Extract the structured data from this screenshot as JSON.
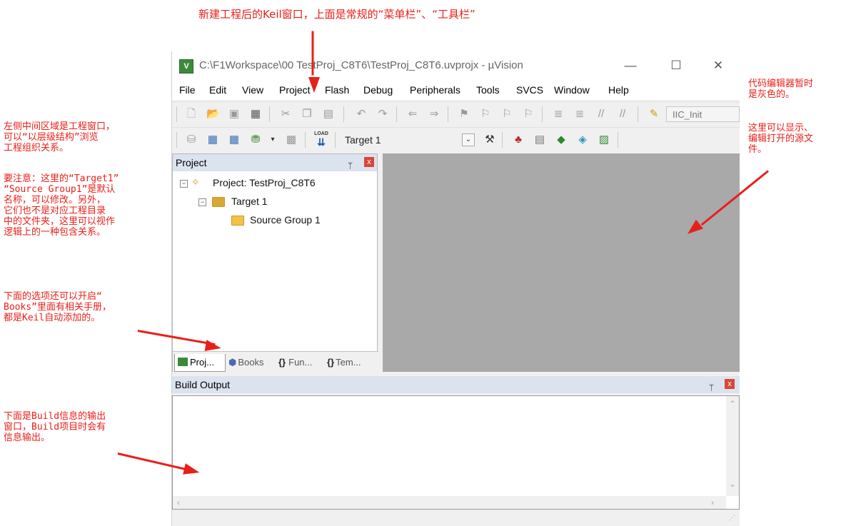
{
  "annotations": {
    "top": "新建工程后的Keil窗口，上面是常规的“菜单栏”、“工具栏”",
    "left_project": "左侧中间区域是工程窗口，\n可以“以层级结构”浏览\n工程组织关系。",
    "left_note": "要注意：这里的“Target1”\n“Source Group1”是默认\n名称，可以修改。另外，\n它们也不是对应工程目录\n中的文件夹，这里可以视作\n逻辑上的一种包含关系。",
    "left_books": "下面的选项还可以开启“\nBooks”里面有相关手册，\n都是Keil自动添加的。",
    "left_build": "下面是Build信息的输出\n窗口，Build项目时会有\n信息输出。",
    "right_editor1": "代码编辑器暂时\n是灰色的。",
    "right_editor2": "这里可以显示、\n编辑打开的源文\n件。"
  },
  "window": {
    "title": "C:\\F1Workspace\\00 TestProj_C8T6\\TestProj_C8T6.uvprojx - µVision",
    "icon_text": "V",
    "minimize": "—",
    "maximize": "☐",
    "close": "✕"
  },
  "menu": [
    "File",
    "Edit",
    "View",
    "Project",
    "Flash",
    "Debug",
    "Peripherals",
    "Tools",
    "SVCS",
    "Window",
    "Help"
  ],
  "toolbar1": {
    "function_combo": "IIC_Init",
    "icons": [
      "new-file-icon",
      "open-folder-icon",
      "save-icon",
      "save-all-icon",
      "cut-icon",
      "copy-icon",
      "paste-icon",
      "undo-icon",
      "redo-icon",
      "nav-back-icon",
      "nav-forward-icon",
      "bookmark-icon",
      "bookmark-prev-icon",
      "bookmark-next-icon",
      "bookmark-clear-icon",
      "indent-icon",
      "unindent-icon",
      "comment-icon",
      "uncomment-icon",
      "find-in-files-icon"
    ]
  },
  "toolbar2": {
    "target_combo": "Target 1",
    "load_label": "LOAD"
  },
  "project_panel": {
    "title": "Project",
    "pin": "ᛘ",
    "close": "x",
    "tree": {
      "project": "Project: TestProj_C8T6",
      "target": "Target 1",
      "group": "Source Group 1"
    },
    "tabs": [
      "Proj...",
      "Books",
      "Fun...",
      "Tem..."
    ]
  },
  "build_output": {
    "title": "Build Output",
    "pin": "ᛘ",
    "close": "x"
  }
}
